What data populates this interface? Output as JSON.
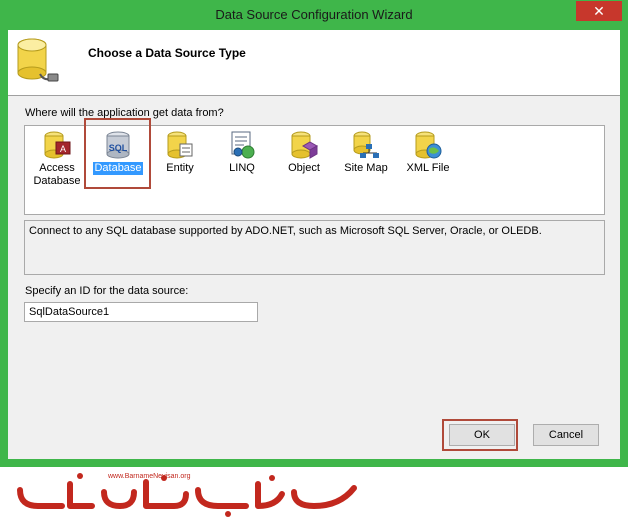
{
  "window": {
    "title": "Data Source Configuration Wizard",
    "close_symbol": "✕"
  },
  "header": {
    "title": "Choose a Data Source Type",
    "icon": "database-plug-icon"
  },
  "types": {
    "label": "Where will the application get data from?",
    "items": [
      {
        "label_line1": "Access",
        "label_line2": "Database",
        "icon": "access-database-icon"
      },
      {
        "label_line1": "Database",
        "label_line2": "",
        "icon": "sql-database-icon",
        "selected": true
      },
      {
        "label_line1": "Entity",
        "label_line2": "",
        "icon": "entity-icon"
      },
      {
        "label_line1": "LINQ",
        "label_line2": "",
        "icon": "linq-icon"
      },
      {
        "label_line1": "Object",
        "label_line2": "",
        "icon": "object-icon"
      },
      {
        "label_line1": "Site Map",
        "label_line2": "",
        "icon": "site-map-icon"
      },
      {
        "label_line1": "XML File",
        "label_line2": "",
        "icon": "xml-file-icon"
      }
    ],
    "description": "Connect to any SQL database supported by ADO.NET, such as Microsoft SQL Server, Oracle, or OLEDB."
  },
  "id_field": {
    "label": "Specify an ID for the data source:",
    "value": "SqlDataSource1"
  },
  "buttons": {
    "ok": "OK",
    "cancel": "Cancel"
  },
  "watermark": {
    "url": "www.BarnameNevisan.org"
  },
  "colors": {
    "frame": "#3fb64a",
    "close": "#c7372c",
    "highlight": "#b04a3a",
    "selection": "#3399ff",
    "logo": "#c2281e"
  }
}
